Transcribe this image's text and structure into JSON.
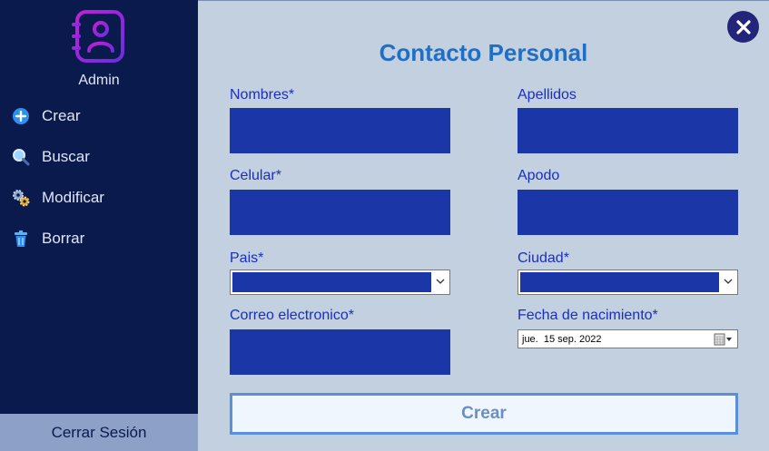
{
  "sidebar": {
    "user_label": "Admin",
    "menu": [
      {
        "label": "Crear",
        "icon": "plus-circle-icon"
      },
      {
        "label": "Buscar",
        "icon": "search-icon"
      },
      {
        "label": "Modificar",
        "icon": "gears-icon"
      },
      {
        "label": "Borrar",
        "icon": "trash-icon"
      }
    ],
    "logout_label": "Cerrar Sesión"
  },
  "form": {
    "title": "Contacto Personal",
    "fields": {
      "nombres": {
        "label": "Nombres*",
        "value": ""
      },
      "apellidos": {
        "label": "Apellidos",
        "value": ""
      },
      "celular": {
        "label": "Celular*",
        "value": ""
      },
      "apodo": {
        "label": "Apodo",
        "value": ""
      },
      "pais": {
        "label": "Pais*",
        "value": ""
      },
      "ciudad": {
        "label": "Ciudad*",
        "value": ""
      },
      "correo": {
        "label": "Correo electronico*",
        "value": ""
      },
      "fecha": {
        "label": "Fecha de nacimiento*",
        "value": "jue.  15 sep. 2022"
      }
    },
    "submit_label": "Crear"
  },
  "colors": {
    "sidebar_bg": "#0b1a4d",
    "content_bg": "#c3d0e0",
    "accent": "#1f6fc6",
    "input_fill": "#1b36a6",
    "label": "#1a2fc0"
  }
}
